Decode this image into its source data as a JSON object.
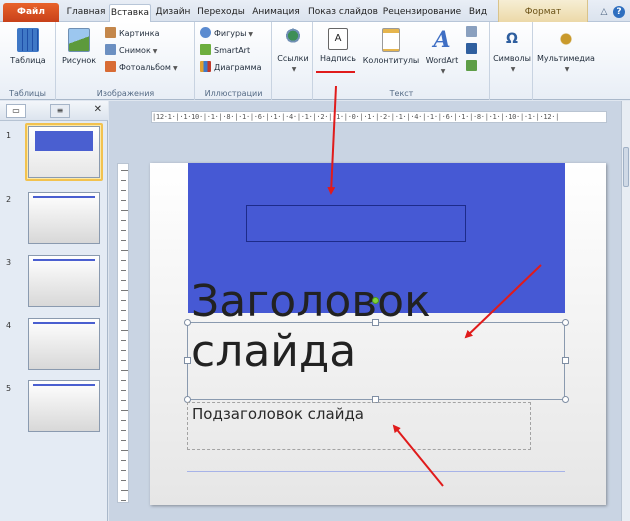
{
  "tabs": {
    "file": "Файл",
    "home": "Главная",
    "insert": "Вставка",
    "design": "Дизайн",
    "transitions": "Переходы",
    "animations": "Анимация",
    "slideshow": "Показ слайдов",
    "review": "Рецензирование",
    "view": "Вид",
    "format": "Формат"
  },
  "ribbon": {
    "tables": {
      "label": "Таблицы",
      "table_btn": "Таблица"
    },
    "images": {
      "label": "Изображения",
      "picture_btn": "Рисунок",
      "clipart_btn": "Картинка",
      "screenshot_btn": "Снимок",
      "album_btn": "Фотоальбом"
    },
    "illustrations": {
      "label": "Иллюстрации",
      "shapes_btn": "Фигуры",
      "smartart_btn": "SmartArt",
      "chart_btn": "Диаграмма"
    },
    "links": {
      "links_btn": "Ссылки"
    },
    "text": {
      "label": "Текст",
      "textbox_btn": "Надпись",
      "headerfooter_btn": "Колонтитулы",
      "wordart_btn": "WordArt"
    },
    "symbols": {
      "symbols_btn": "Символы"
    },
    "media": {
      "media_btn": "Мультимедиа"
    }
  },
  "slides_pane": {
    "numbers": [
      "1",
      "2",
      "3",
      "4",
      "5"
    ]
  },
  "ruler": {
    "horizontal": "|12·1·|·1·10·|·1·|·8·|·1·|·6·|·1·|·4·|·1·|·2·|·1·|·0·|·1·|·2·|·1·|·4·|·1·|·6·|·1·|·8·|·1·|·10·|·1·|·12·|"
  },
  "slide": {
    "title_placeholder": "Заголовок слайда",
    "subtitle_placeholder": "Подзаголовок слайда"
  },
  "colors": {
    "accent_red": "#e01b1b",
    "slide_blue": "#4659d4",
    "file_tab": "#d3501f"
  }
}
